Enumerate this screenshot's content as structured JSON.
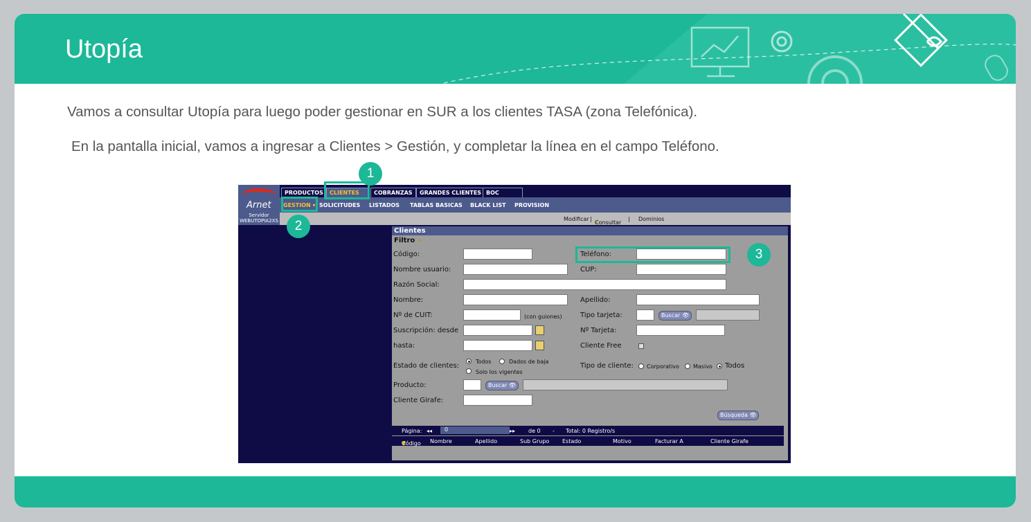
{
  "slide": {
    "title": "Utopía",
    "line1": "Vamos a consultar Utopía para luego poder gestionar en SUR a los clientes TASA (zona Telefónica).",
    "line2": "En la pantalla inicial, vamos a ingresar a Clientes > Gestión,  y completar la línea en el campo Teléfono.",
    "accent": "#1cb898"
  },
  "badges": [
    "1",
    "2",
    "3"
  ],
  "app": {
    "logo": "Arnet",
    "server_label": "Servidor",
    "server_name": "WEBUTOPIA2XS",
    "tabs": [
      "PRODUCTOS",
      "CLIENTES",
      "COBRANZAS",
      "GRANDES CLIENTES",
      "BOC"
    ],
    "active_tab": "CLIENTES",
    "menu": [
      "GESTION",
      "SOLICITUDES",
      "LISTADOS",
      "TABLAS BASICAS",
      "BLACK LIST",
      "PROVISION"
    ],
    "actions": [
      "Modificar",
      "|",
      "Consultar",
      "|",
      "Dominios"
    ]
  },
  "panel": {
    "title": "Clientes",
    "filter": "Filtro",
    "codigo": "Código:",
    "telefono": "Teléfono:",
    "nombre_usuario": "Nombre usuario:",
    "cup": "CUP:",
    "razon_social": "Razón Social:",
    "nombre": "Nombre:",
    "apellido": "Apellido:",
    "cuit": "Nº de CUIT:",
    "con_guiones": "(con guiones)",
    "tipo_tarjeta": "Tipo tarjeta:",
    "buscar": "Buscar",
    "suscripcion": "Suscripción:  desde",
    "nro_tarjeta": "Nº Tarjeta:",
    "hasta": "hasta:",
    "cliente_free": "Cliente Free",
    "estado": "Estado de clientes:",
    "todos": "Todos",
    "dados_baja": "Dados de baja",
    "solo_vigentes": "Solo los vigentes",
    "tipo_cliente": "Tipo de cliente:",
    "corporativo": "Corporativo",
    "masivo": "Masivo",
    "todos2": "Todos",
    "producto": "Producto:",
    "cliente_girafe": "Cliente Girafe:",
    "busqueda": "Búsqueda",
    "pagina": "Página:",
    "page_value": "0",
    "de": "de 0",
    "dash": "-",
    "total": "Total: 0 Registro/s",
    "columns": [
      "Código",
      "Nombre",
      "Apellido",
      "Sub Grupo",
      "Estado",
      "Motivo",
      "Facturar A",
      "Cliente Girafe"
    ]
  }
}
